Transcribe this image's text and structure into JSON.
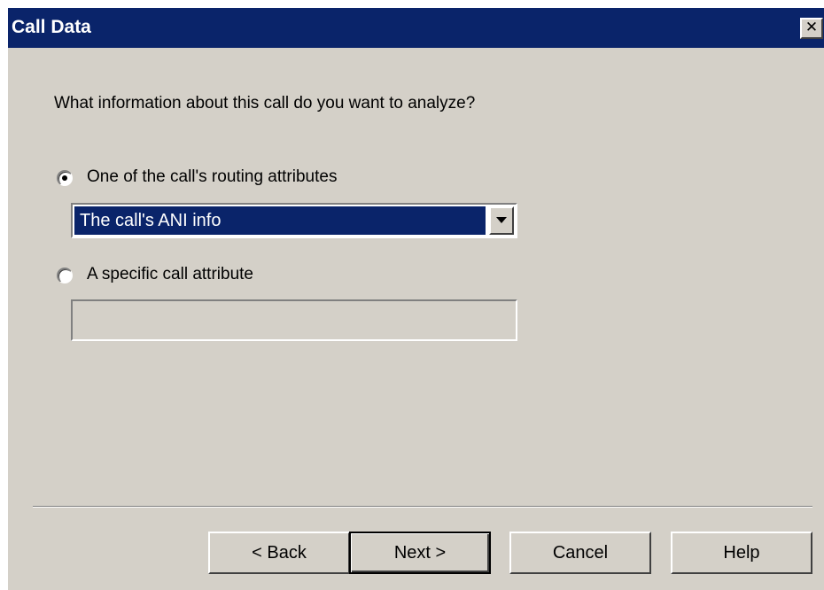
{
  "window": {
    "title": "Call Data",
    "close_label": "✕"
  },
  "form": {
    "question": "What information about this call do you want to analyze?",
    "options": [
      {
        "label": "One of the call's routing attributes",
        "selected": true
      },
      {
        "label": "A specific call attribute",
        "selected": false
      }
    ],
    "routing_attribute_selected": "The call's ANI info",
    "specific_attribute_value": ""
  },
  "buttons": {
    "back": "< Back",
    "next": "Next >",
    "cancel": "Cancel",
    "help": "Help"
  },
  "colors": {
    "dialog_bg": "#d4d0c8",
    "titlebar_bg": "#0a246a",
    "selection_bg": "#0a246a"
  }
}
